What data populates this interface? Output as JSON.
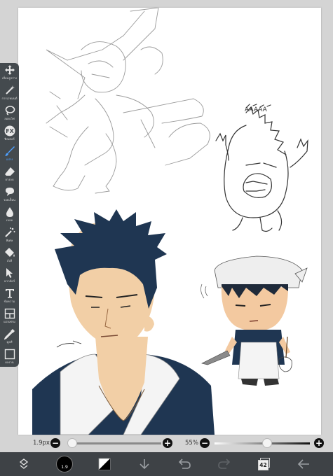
{
  "toolbar": {
    "tools": [
      {
        "label": "เลื่อนรูปร่าง",
        "icon": "move-icon"
      },
      {
        "label": "การเวทมนต์",
        "icon": "magic-wand-icon"
      },
      {
        "label": "ลอดเวิฟ",
        "icon": "lasso-icon"
      },
      {
        "label": "ฟิลเตอร์",
        "icon": "fx-filter-icon"
      },
      {
        "label": "แปรง",
        "icon": "brush-icon",
        "active": true
      },
      {
        "label": "ยางลบ",
        "icon": "eraser-icon"
      },
      {
        "label": "รอยเปื้อน",
        "icon": "smudge-icon"
      },
      {
        "label": "เบลอ",
        "icon": "blur-drop-icon"
      },
      {
        "label": "พิเศษ",
        "icon": "special-effect-icon"
      },
      {
        "label": "ถังสี",
        "icon": "fill-bucket-icon"
      },
      {
        "label": "ฉากลัดร์",
        "icon": "select-arrow-icon"
      },
      {
        "label": "ข้อความ",
        "icon": "text-tool-icon"
      },
      {
        "label": "แบ่งเฟรม",
        "icon": "frame-divider-icon"
      },
      {
        "label": "ดูดสี",
        "icon": "eyedropper-icon"
      },
      {
        "label": "ผลงาน",
        "icon": "canvas-icon"
      }
    ]
  },
  "brush_size": {
    "value_label": "1.9px",
    "level": 0.04
  },
  "opacity": {
    "value_label": "55%",
    "level": 0.55
  },
  "bottom_bar": {
    "color_swatch_label": "1.9",
    "layer_count": "42",
    "icons": [
      "transform-icon",
      "color-swatch-icon",
      "color-picker-icon",
      "import-icon",
      "undo-icon",
      "redo-icon",
      "layers-icon",
      "back-icon"
    ]
  },
  "colors": {
    "toolbar_bg": "#444a4e",
    "accent": "#4ea0ff",
    "bottom_bar_bg": "#3e4246",
    "ink_navy": "#1f3652",
    "skin": "#f2cfa6"
  }
}
